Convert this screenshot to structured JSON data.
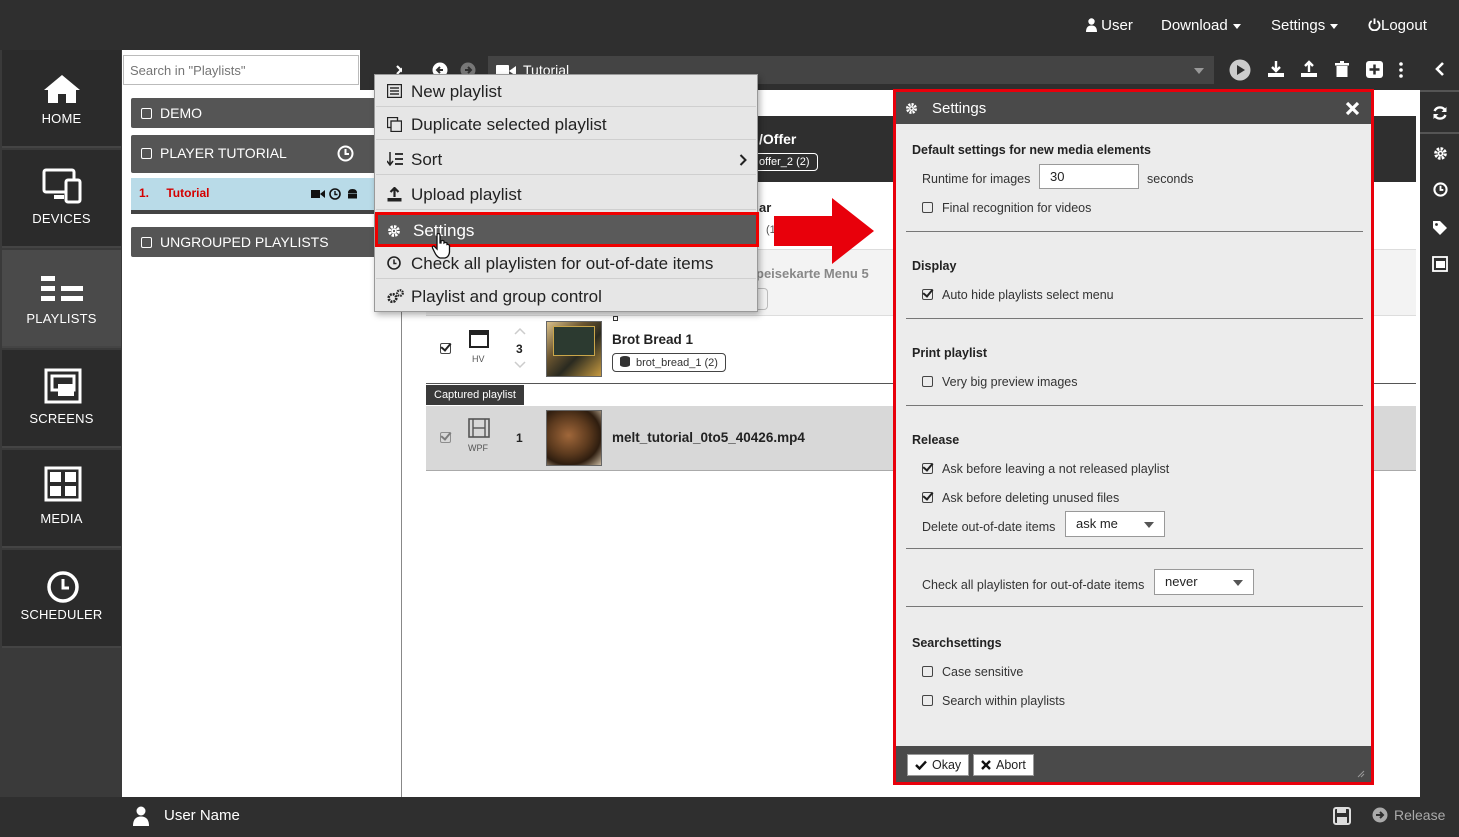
{
  "topbar": {
    "user": "User",
    "download": "Download",
    "settings": "Settings",
    "logout": "Logout"
  },
  "nav": {
    "home": "HOME",
    "devices": "DEVICES",
    "playlists": "PLAYLISTS",
    "screens": "SCREENS",
    "media": "MEDIA",
    "scheduler": "SCHEDULER"
  },
  "playlists_panel": {
    "search_placeholder": "Search in \"Playlists\"",
    "groups": [
      "DEMO",
      "PLAYER TUTORIAL",
      "UNGROUPED PLAYLISTS"
    ],
    "selected_item_index": "1.",
    "selected_item": "Tutorial"
  },
  "content": {
    "playlist_name": "Tutorial",
    "header_fragment": "/Offer",
    "header_tag": "offer_2 (2)",
    "row_fragment_a": "ar",
    "row_fragment_b": "(1",
    "row_fragment_menu": "peisekarte Menu 5",
    "rows": [
      {
        "icon_label": "HV",
        "number": "3",
        "title": "Brot Bread 1",
        "tag": "brot_bread_1 (2)"
      },
      {
        "icon_label": "WPF",
        "number": "1",
        "title": "melt_tutorial_0to5_40426.mp4"
      }
    ],
    "captured_label": "Captured playlist"
  },
  "menu": {
    "items": [
      "New playlist",
      "Duplicate selected playlist",
      "Sort",
      "Upload playlist",
      "Settings",
      "Check all playlisten for out-of-date items",
      "Playlist and group control"
    ]
  },
  "dialog": {
    "title": "Settings",
    "sections": {
      "defaults": "Default settings for new media elements",
      "display": "Display",
      "print": "Print playlist",
      "release": "Release",
      "search": "Searchsettings"
    },
    "runtime_label": "Runtime for images",
    "runtime_value": "30",
    "runtime_unit": "seconds",
    "final_recognition": "Final recognition for videos",
    "auto_hide": "Auto hide playlists select menu",
    "big_preview": "Very big preview images",
    "ask_leaving": "Ask before leaving a not released playlist",
    "ask_deleting": "Ask before deleting unused files",
    "delete_outdated_label": "Delete out-of-date items",
    "delete_outdated_value": "ask me",
    "check_all_label": "Check all playlisten for out-of-date items",
    "check_all_value": "never",
    "case_sensitive": "Case sensitive",
    "search_within": "Search within playlists",
    "okay": "Okay",
    "abort": "Abort"
  },
  "bottombar": {
    "user_name": "User Name",
    "release": "Release"
  }
}
